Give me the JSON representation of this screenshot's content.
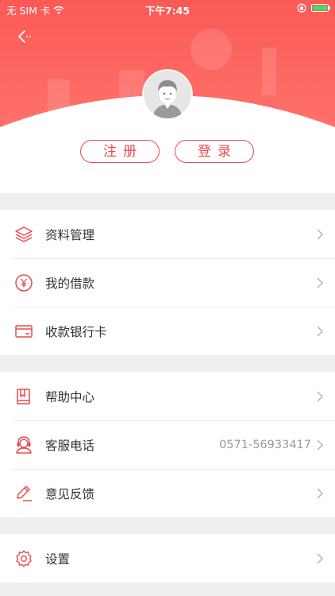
{
  "status_bar": {
    "carrier": "无 SIM 卡",
    "time": "下午7:45",
    "battery_level": 1.0
  },
  "header": {
    "back_icon": "back-arrow-icon",
    "avatar_icon": "default-avatar-icon",
    "register_label": "注册",
    "login_label": "登录"
  },
  "colors": {
    "brand": "#ec4a4f",
    "header_gradient_top": "#fb5b55",
    "header_gradient_bottom": "#ff6f6a",
    "background": "#efefef"
  },
  "menu": {
    "group1": [
      {
        "label": "资料管理",
        "icon": "layers-icon"
      },
      {
        "label": "我的借款",
        "icon": "yuan-coin-icon"
      },
      {
        "label": "收款银行卡",
        "icon": "bank-card-icon"
      }
    ],
    "group2": [
      {
        "label": "帮助中心",
        "icon": "help-book-icon"
      },
      {
        "label": "客服电话",
        "icon": "headset-icon",
        "value": "0571-56933417"
      },
      {
        "label": "意见反馈",
        "icon": "pencil-icon"
      }
    ],
    "group3": [
      {
        "label": "设置",
        "icon": "gear-icon"
      }
    ]
  }
}
